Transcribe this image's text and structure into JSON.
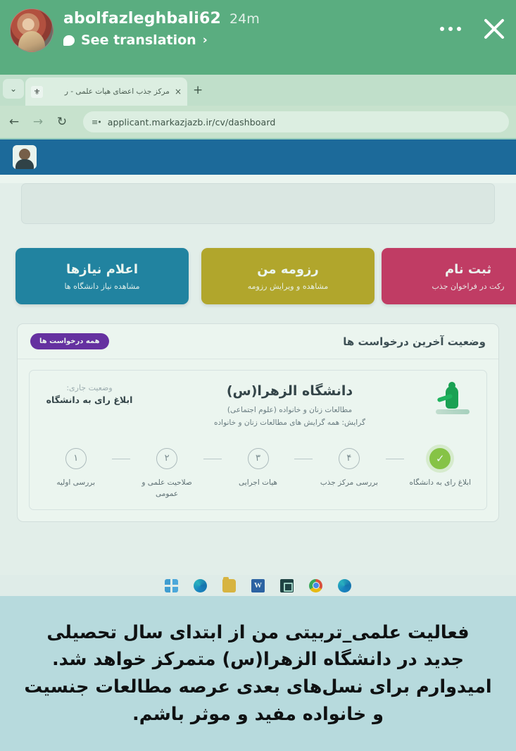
{
  "story": {
    "username": "abolfazleghbali62",
    "timestamp": "24m",
    "translate_label": "See translation",
    "chevron": "›",
    "avatar_name": "story-avatar",
    "more_icon": "more-options-icon",
    "close_icon": "close-icon"
  },
  "browser": {
    "tab": {
      "title": "مرکز جذب اعضای هیأت علمی - ر",
      "favicon": "site-favicon",
      "close": "×",
      "new_tab": "+"
    },
    "tab_list_chevron": "⌄",
    "nav": {
      "back": "←",
      "forward": "→",
      "reload": "↻"
    },
    "url": "applicant.markazjazb.ir/cv/dashboard",
    "url_icon": "site-settings-icon"
  },
  "site": {
    "navbar_avatar": "user-profile-photo",
    "cards": [
      {
        "title": "اعلام نیازها",
        "subtitle": "مشاهده نیاز دانشگاه ها",
        "color": "#1a7ea6",
        "name": "card-needs"
      },
      {
        "title": "رزومه من",
        "subtitle": "مشاهده و ویرایش رزومه",
        "color": "#bda521",
        "name": "card-resume"
      },
      {
        "title": "ثبت نام",
        "subtitle": "رکت در فراخوان جذب",
        "color": "#cf2d61",
        "name": "card-register"
      }
    ],
    "requests": {
      "title": "وضعیت آخرین درخواست ها",
      "badge": "همه درخواست ها",
      "badge_color": "#6720a6",
      "university": "دانشگاه الزهرا(س)",
      "field_line1": "مطالعات زنان و خانواده (علوم اجتماعی)",
      "field_line2": "گرایش: همه گرایش های مطالعات زنان و خانواده",
      "status_label": "وضعیت جاری:",
      "status_value": "ابلاغ رای به دانشگاه",
      "logo_name": "alzahra-university-logo",
      "steps": [
        {
          "num": "۱",
          "label": "بررسی اولیه",
          "done": false
        },
        {
          "num": "۲",
          "label": "صلاحیت علمی و عمومی",
          "done": false
        },
        {
          "num": "۳",
          "label": "هیات اجرایی",
          "done": false
        },
        {
          "num": "۴",
          "label": "بررسی مرکز جذب",
          "done": false
        },
        {
          "num": "✓",
          "label": "ابلاغ رای به دانشگاه",
          "done": true
        }
      ]
    }
  },
  "taskbar": {
    "icons": [
      "windows-start-icon",
      "edge-icon",
      "file-explorer-icon",
      "word-icon",
      "app-icon",
      "chrome-icon",
      "edge-icon-2"
    ]
  },
  "caption": {
    "text": "فعالیت علمی_تربیتی من از ابتدای سال تحصیلی جدید در دانشگاه الزهرا(س) متمرکز خواهد شد. امیدوارم برای نسل‌های بعدی عرصه مطالعات جنسیت و خانواده مفید و موثر باشم."
  }
}
